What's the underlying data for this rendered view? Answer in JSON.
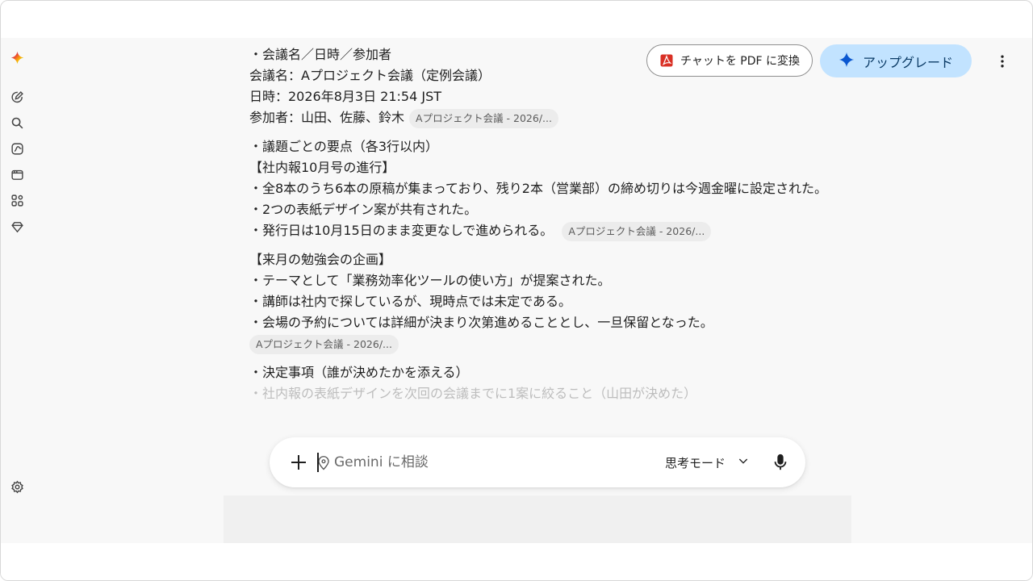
{
  "header": {
    "pdf_label": "チャットを PDF に変換",
    "upgrade_label": "アップグレード"
  },
  "chat": {
    "s1": [
      "・会議名／日時／参加者",
      "会議名：Aプロジェクト会議（定例会議）",
      "日時：2026年8月3日 21:54 JST",
      "参加者：山田、佐藤、鈴木"
    ],
    "chip1": "Aプロジェクト会議 - 2026/...",
    "s2": [
      "・議題ごとの要点（各3行以内）",
      "【社内報10月号の進行】",
      "・全8本のうち6本の原稿が集まっており、残り2本（営業部）の締め切りは今週金曜に設定された。",
      "・2つの表紙デザイン案が共有された。",
      "・発行日は10月15日のまま変更なしで進められる。"
    ],
    "chip2": "Aプロジェクト会議 - 2026/...",
    "s3": [
      "【来月の勉強会の企画】",
      "・テーマとして「業務効率化ツールの使い方」が提案された。",
      "・講師は社内で探しているが、現時点では未定である。",
      "・会場の予約については詳細が決まり次第進めることとし、一旦保留となった。"
    ],
    "chip3": "Aプロジェクト会議 - 2026/...",
    "s4": [
      "・決定事項（誰が決めたかを添える）",
      "・社内報の表紙デザインを次回の会議までに1案に絞ること（山田が決めた）"
    ]
  },
  "composer": {
    "placeholder": "Gemini に相談",
    "mode_label": "思考モード"
  },
  "icons": {
    "sidebar": [
      "gemini-logo-icon",
      "new-chat-icon",
      "search-icon",
      "gems-icon",
      "library-icon",
      "apps-icon",
      "saved-info-icon",
      "settings-icon"
    ],
    "composer": [
      "plus-icon",
      "location-pin-icon",
      "chevron-down-icon",
      "mic-icon"
    ]
  },
  "colors": {
    "upgrade_bg": "#c2e3ff",
    "pdf_red": "#d93025",
    "chip_bg": "#ececec"
  }
}
